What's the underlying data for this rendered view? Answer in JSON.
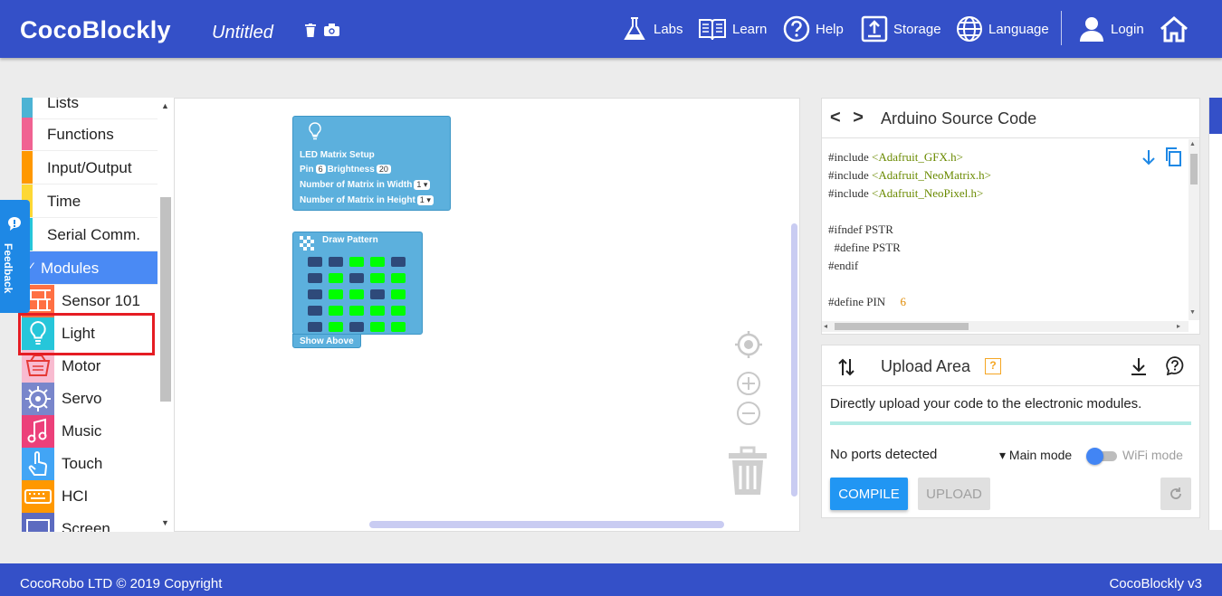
{
  "header": {
    "brand": "CocoBlockly",
    "doc_title": "Untitled",
    "nav": {
      "labs": "Labs",
      "learn": "Learn",
      "help": "Help",
      "storage": "Storage",
      "language": "Language",
      "login": "Login"
    },
    "colors": {
      "bar": "#3450c8"
    }
  },
  "feedback": {
    "label": "Feedback"
  },
  "toolbox": {
    "categories": [
      {
        "label": "Lists",
        "color": "#4cb3d4"
      },
      {
        "label": "Functions",
        "color": "#f06292"
      },
      {
        "label": "Input/Output",
        "color": "#ff9800"
      },
      {
        "label": "Time",
        "color": "#fdd835"
      },
      {
        "label": "Serial Comm.",
        "color": "#26c6da"
      }
    ],
    "modules_label": "Modules",
    "modules": [
      {
        "label": "Sensor 101",
        "icon": "sensor-icon",
        "color": "#ff7043"
      },
      {
        "label": "Light",
        "icon": "lightbulb-icon",
        "color": "#26c6da"
      },
      {
        "label": "Motor",
        "icon": "motor-icon",
        "color": "#f8bbd0"
      },
      {
        "label": "Servo",
        "icon": "servo-icon",
        "color": "#7986cb"
      },
      {
        "label": "Music",
        "icon": "music-icon",
        "color": "#ec407a"
      },
      {
        "label": "Touch",
        "icon": "touch-icon",
        "color": "#42a5f5"
      },
      {
        "label": "HCI",
        "icon": "hci-icon",
        "color": "#ff9800"
      },
      {
        "label": "Screen",
        "icon": "screen-icon",
        "color": "#5c6bc0"
      }
    ]
  },
  "workspace": {
    "setup_block": {
      "title": "LED Matrix Setup",
      "pin_label": "Pin",
      "pin_value": "6",
      "brightness_label": "Brightness",
      "brightness_value": "20",
      "width_label": "Number of Matrix in Width",
      "width_value": "1",
      "height_label": "Number of Matrix in Height",
      "height_value": "1"
    },
    "pattern_block": {
      "title": "Draw Pattern",
      "footer": "Show Above",
      "grid": [
        [
          0,
          0,
          1,
          1,
          0
        ],
        [
          0,
          1,
          0,
          1,
          1
        ],
        [
          0,
          1,
          1,
          0,
          1
        ],
        [
          0,
          1,
          1,
          1,
          1
        ],
        [
          0,
          1,
          0,
          1,
          1
        ]
      ],
      "on_color": "#00ff00",
      "off_color": "#2e4a7a"
    }
  },
  "code_panel": {
    "nav": "< >",
    "title": "Arduino Source Code",
    "lines": [
      {
        "pre": "#include ",
        "str": "<Adafruit_GFX.h>",
        "num": ""
      },
      {
        "pre": "#include ",
        "str": "<Adafruit_NeoMatrix.h>",
        "num": ""
      },
      {
        "pre": "#include ",
        "str": "<Adafruit_NeoPixel.h>",
        "num": ""
      },
      {
        "pre": "",
        "str": "",
        "num": ""
      },
      {
        "pre": "#ifndef PSTR",
        "str": "",
        "num": ""
      },
      {
        "pre": "  #define PSTR",
        "str": "",
        "num": ""
      },
      {
        "pre": "#endif",
        "str": "",
        "num": ""
      },
      {
        "pre": "",
        "str": "",
        "num": ""
      },
      {
        "pre": "#define PIN     ",
        "str": "",
        "num": "6"
      }
    ],
    "colors": {
      "string": "#6a8a00",
      "number": "#e08a00"
    }
  },
  "upload_panel": {
    "title": "Upload Area",
    "description": "Directly upload your code to the electronic modules.",
    "ports": "No ports detected",
    "main_mode": "▾ Main mode",
    "wifi_mode": "WiFi mode",
    "compile": "COMPILE",
    "upload": "UPLOAD"
  },
  "footer": {
    "copyright": "CocoRobo LTD © 2019 Copyright",
    "version": "CocoBlockly v3"
  }
}
